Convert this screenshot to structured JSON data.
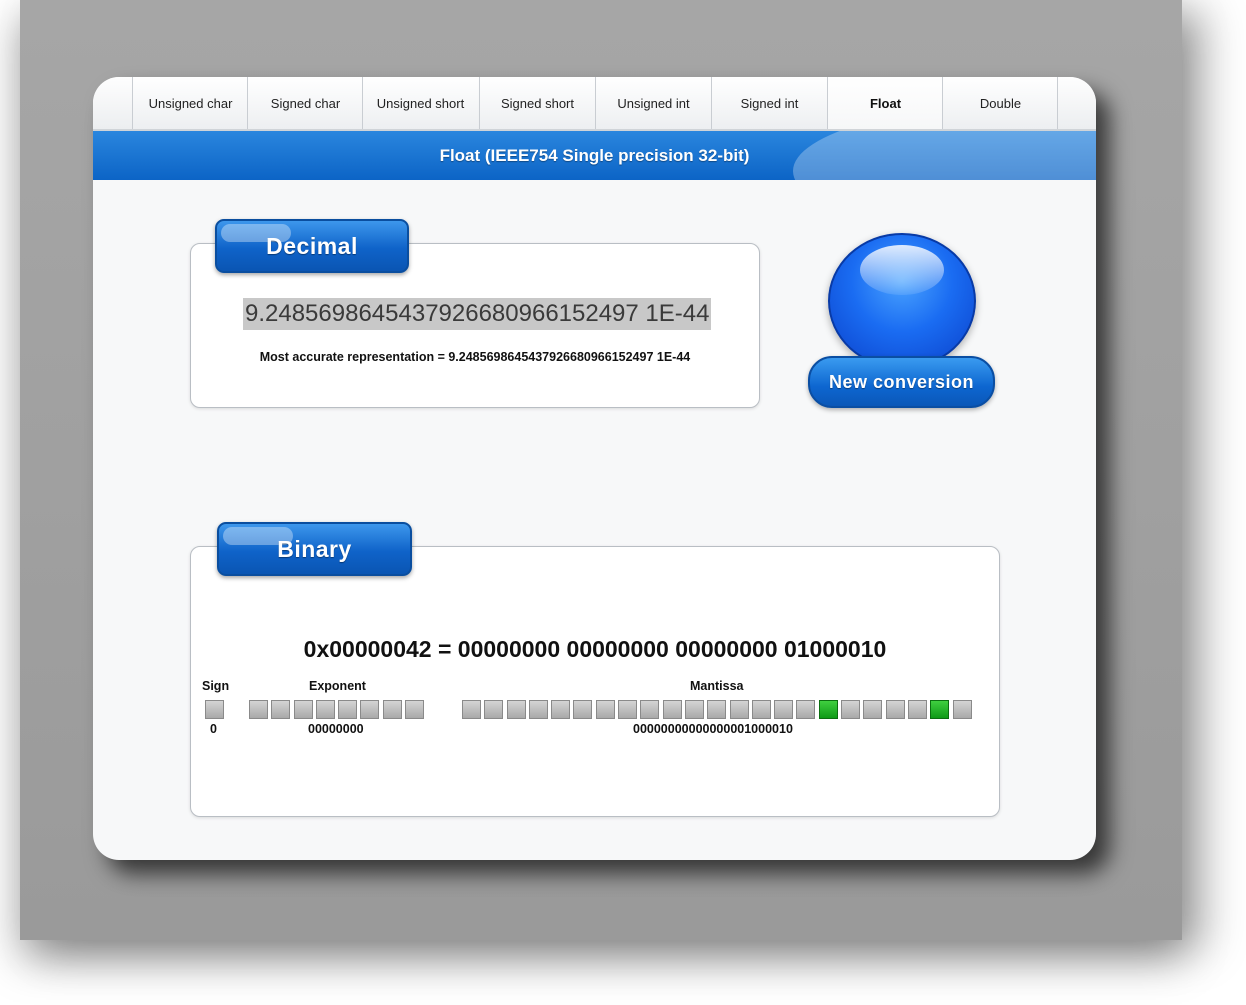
{
  "tabs": [
    {
      "label": "Unsigned char",
      "active": false
    },
    {
      "label": "Signed char",
      "active": false
    },
    {
      "label": "Unsigned short",
      "active": false
    },
    {
      "label": "Signed short",
      "active": false
    },
    {
      "label": "Unsigned int",
      "active": false
    },
    {
      "label": "Signed int",
      "active": false
    },
    {
      "label": "Float",
      "active": true
    },
    {
      "label": "Double",
      "active": false
    }
  ],
  "banner": {
    "title": "Float (IEEE754 Single precision 32-bit)"
  },
  "decimal": {
    "heading": "Decimal",
    "value": "9.2485698645437926680966152497 1E-44",
    "most_accurate": "Most accurate representation = 9.2485698645437926680966152497 1E-44"
  },
  "new_conversion": {
    "label": "New conversion"
  },
  "binary": {
    "heading": "Binary",
    "hex_line": "0x00000042 = 00000000 00000000 00000000 01000010",
    "sign": {
      "label": "Sign",
      "value": "0",
      "bits": [
        0
      ]
    },
    "exponent": {
      "label": "Exponent",
      "value": "00000000",
      "bits": [
        0,
        0,
        0,
        0,
        0,
        0,
        0,
        0
      ]
    },
    "mantissa": {
      "label": "Mantissa",
      "value": "00000000000000001000010",
      "bits": [
        0,
        0,
        0,
        0,
        0,
        0,
        0,
        0,
        0,
        0,
        0,
        0,
        0,
        0,
        0,
        0,
        1,
        0,
        0,
        0,
        0,
        1,
        0
      ]
    }
  },
  "colors": {
    "accent": "#0c64c6",
    "bit_on": "#15a01d",
    "bit_off": "#b5b5b5"
  }
}
